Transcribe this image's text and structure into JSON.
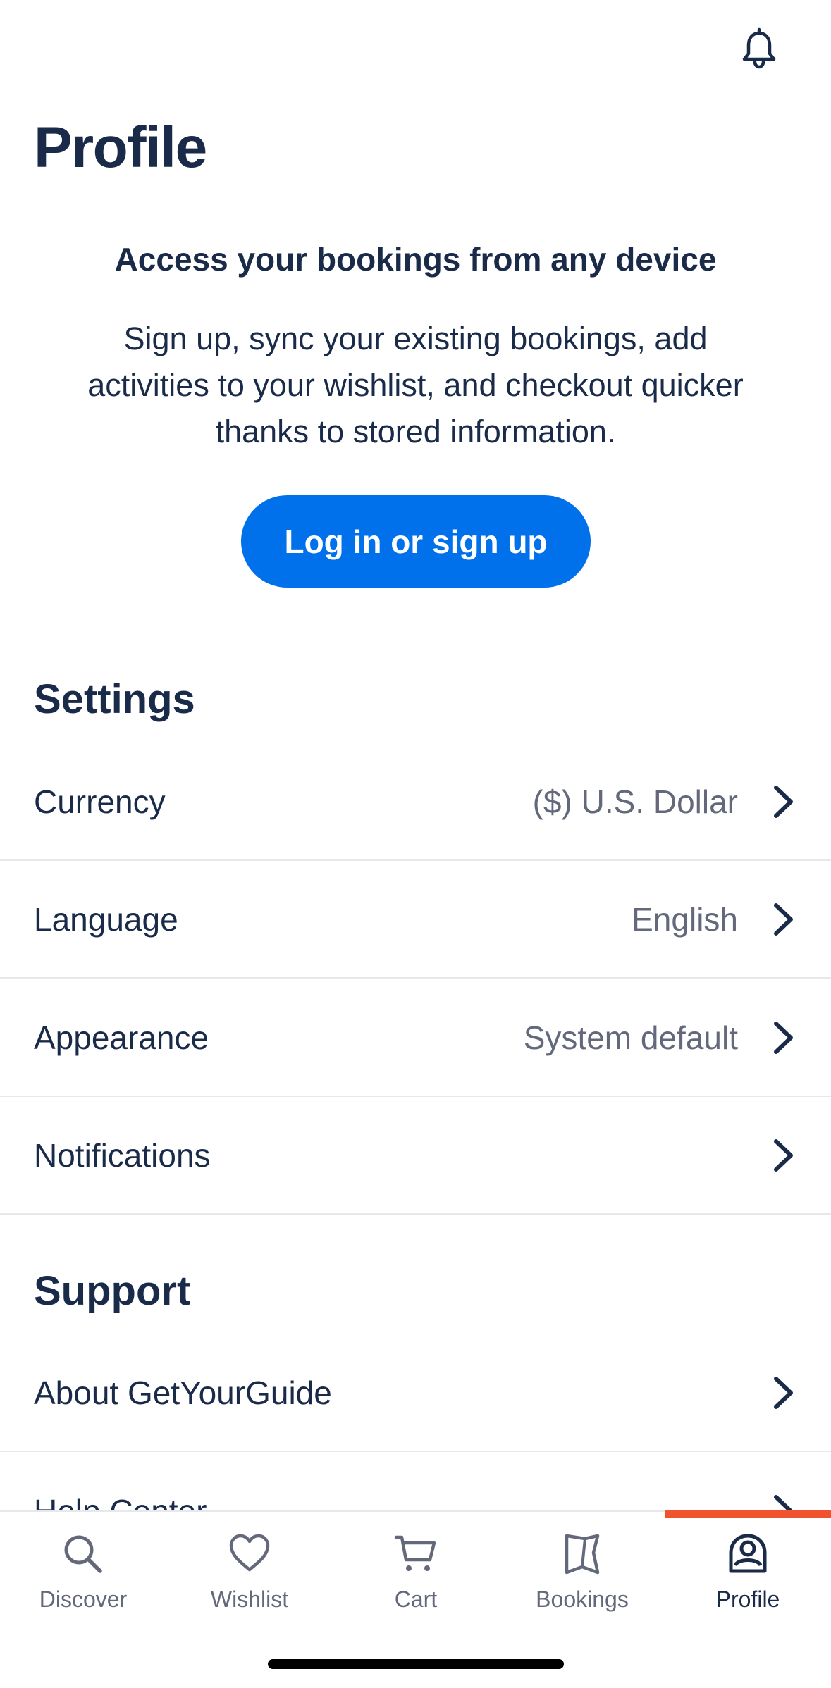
{
  "header": {
    "title": "Profile",
    "notifications_icon": "bell-icon"
  },
  "promo": {
    "heading": "Access your bookings from any device",
    "body": "Sign up, sync your existing bookings, add activities to your wishlist, and checkout quicker thanks to stored information.",
    "button_label": "Log in or sign up",
    "button_color": "#0071eb"
  },
  "settings": {
    "title": "Settings",
    "items": [
      {
        "label": "Currency",
        "value": "($) U.S. Dollar"
      },
      {
        "label": "Language",
        "value": "English"
      },
      {
        "label": "Appearance",
        "value": "System default"
      },
      {
        "label": "Notifications",
        "value": ""
      }
    ]
  },
  "support": {
    "title": "Support",
    "items": [
      {
        "label": "About GetYourGuide"
      },
      {
        "label": "Help Center"
      }
    ]
  },
  "tabbar": {
    "active": "Profile",
    "accent_color": "#f1532e",
    "tabs": [
      {
        "label": "Discover",
        "icon": "search-icon"
      },
      {
        "label": "Wishlist",
        "icon": "heart-icon"
      },
      {
        "label": "Cart",
        "icon": "cart-icon"
      },
      {
        "label": "Bookings",
        "icon": "bookmark-icon"
      },
      {
        "label": "Profile",
        "icon": "profile-icon"
      }
    ]
  }
}
